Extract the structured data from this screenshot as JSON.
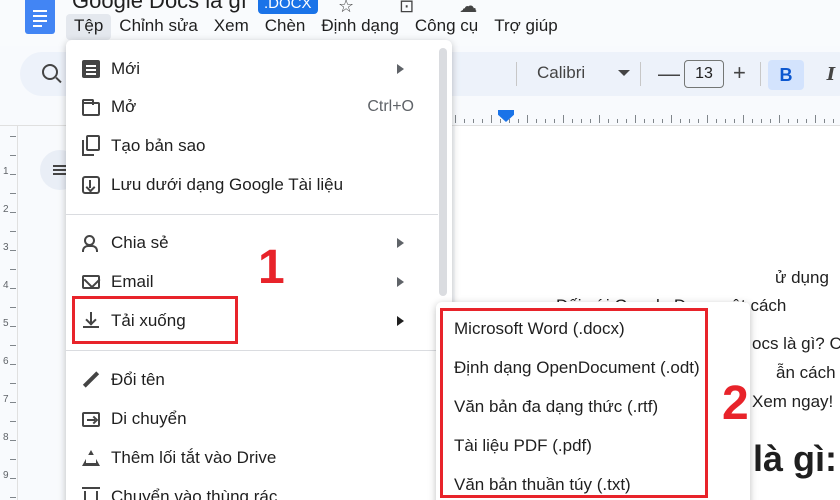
{
  "doc": {
    "title": "Google Docs là gì",
    "badge": ".DOCX",
    "title_icons": "☆ ⊡ ☁"
  },
  "menubar": [
    "Tệp",
    "Chỉnh sửa",
    "Xem",
    "Chèn",
    "Định dạng",
    "Công cụ",
    "Trợ giúp"
  ],
  "toolbar": {
    "font": "Calibri",
    "font_size": "13",
    "minus": "—",
    "plus": "+",
    "bold": "B",
    "italic": "I"
  },
  "vruler_numbers": [
    "1",
    "2",
    "3",
    "4",
    "5",
    "6",
    "7",
    "8",
    "9"
  ],
  "file_menu": {
    "items": [
      {
        "label": "Mới",
        "icon": "document-icon",
        "submenu": true
      },
      {
        "label": "Mở",
        "icon": "folder-icon",
        "shortcut": "Ctrl+O"
      },
      {
        "label": "Tạo bản sao",
        "icon": "copy-icon"
      },
      {
        "label": "Lưu dưới dạng Google Tài liệu",
        "icon": "save-icon"
      },
      {
        "label": "Chia sẻ",
        "icon": "person-add-icon",
        "submenu": true
      },
      {
        "label": "Email",
        "icon": "mail-icon",
        "submenu": true
      },
      {
        "label": "Tải xuống",
        "icon": "download-icon",
        "submenu": true
      },
      {
        "label": "Đổi tên",
        "icon": "pencil-icon"
      },
      {
        "label": "Di chuyển",
        "icon": "move-folder-icon"
      },
      {
        "label": "Thêm lối tắt vào Drive",
        "icon": "drive-shortcut-icon"
      },
      {
        "label": "Chuyển vào thùng rác",
        "icon": "trash-icon"
      }
    ]
  },
  "download_submenu": [
    "Microsoft Word (.docx)",
    "Định dạng OpenDocument (.odt)",
    "Văn bản đa dạng thức (.rtf)",
    "Tài liệu PDF (.pdf)",
    "Văn bản thuần túy (.txt)"
  ],
  "annotations": {
    "step1": "1",
    "step2": "2"
  },
  "doc_body": {
    "line1": "ử dụng",
    "line2": "Đối với Google Docs một cách",
    "line3": "ocs là gì? C",
    "line4": "ẫn cách tạ",
    "line5": "Xem ngay!",
    "heading": "là gì:"
  },
  "colors": {
    "annotation_red": "#e8232a",
    "accent_blue": "#1a73e8"
  }
}
